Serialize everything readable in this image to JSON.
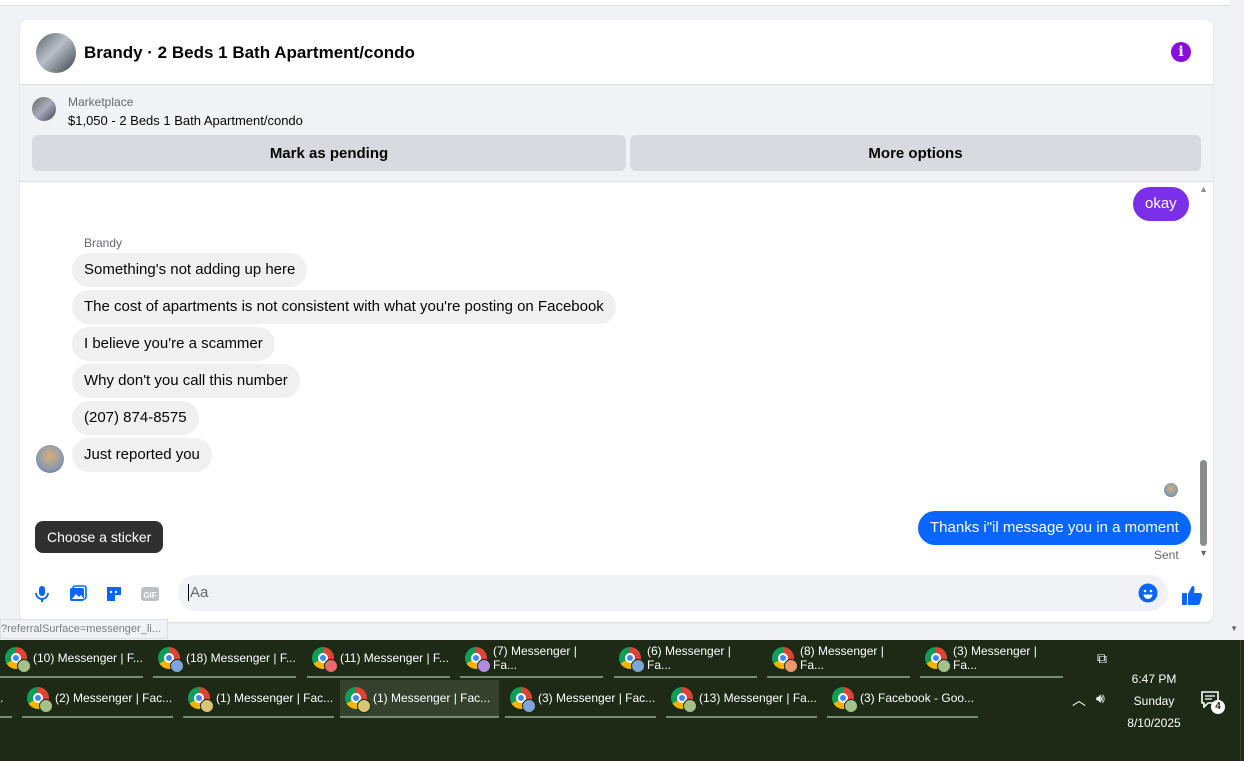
{
  "header": {
    "title": "Brandy · 2 Beds 1 Bath Apartment/condo",
    "info_icon": "i"
  },
  "marketplace": {
    "label": "Marketplace",
    "listing": "$1,050 - 2 Beds 1 Bath Apartment/condo",
    "pending_button": "Mark as pending",
    "more_button": "More options"
  },
  "messages": {
    "sender_name": "Brandy",
    "outgoing_top": "okay",
    "incoming": [
      "Something's not adding up here",
      "The cost of apartments is not consistent with what you're posting on Facebook",
      "I believe you're a scammer",
      "Why don't you call this number",
      "(207) 874-8575",
      "Just reported you"
    ],
    "outgoing_last": "Thanks i\"il message you in a moment",
    "status": "Sent"
  },
  "tooltip": "Choose a sticker",
  "composer": {
    "placeholder": "Aa",
    "gif_label": "GIF"
  },
  "status_url": "?referralSurface=messenger_li...",
  "taskbar": {
    "row1": [
      "(10) Messenger | F...",
      "(18) Messenger | F...",
      "(11) Messenger | F...",
      "(7) Messenger | Fa...",
      "(6) Messenger | Fa...",
      "(8) Messenger | Fa...",
      "(3) Messenger | Fa..."
    ],
    "row2": [
      "(2) Messenger | Fac...",
      "(1) Messenger | Fac...",
      "(1) Messenger | Fac...",
      "(3) Messenger | Fac...",
      "(13) Messenger | Fa...",
      "(3) Facebook - Goo..."
    ],
    "row2_prefix": "."
  },
  "clock": {
    "time": "6:47 PM",
    "day": "Sunday",
    "date": "8/10/2025"
  },
  "notifications": {
    "count": "4"
  },
  "colors": {
    "accent_blue": "#0866ff",
    "accent_purple": "#7b2fe8",
    "taskbar_bg": "#1c2a16"
  }
}
